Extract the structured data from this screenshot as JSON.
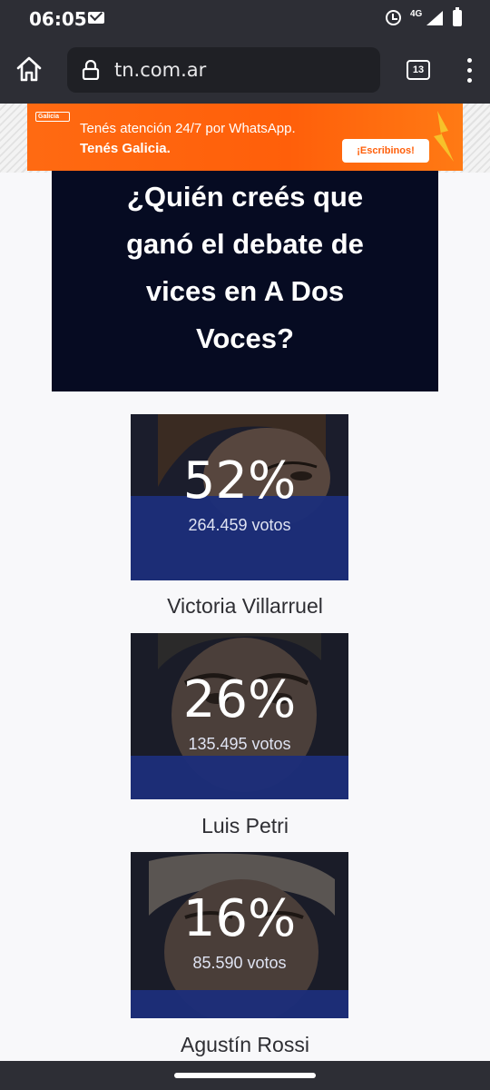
{
  "status_bar": {
    "time": "06:05",
    "network": "4G",
    "icons": [
      "mail-icon",
      "alarm-icon",
      "signal-icon",
      "battery-icon"
    ]
  },
  "browser": {
    "url": "tn.com.ar",
    "tab_count": "13",
    "icons": [
      "home-icon",
      "lock-icon",
      "menu-icon"
    ]
  },
  "ad": {
    "logo": "Galicia",
    "line1": "Tenés atención 24/7 por WhatsApp.",
    "line2": "Tenés Galicia.",
    "cta": "¡Escribinos!"
  },
  "poll": {
    "question": "¿Quién creés que ganó el debate de vices en A Dos Voces?",
    "results": [
      {
        "percent": "52%",
        "share": 52,
        "votes": "264.459 votos",
        "name": "Victoria Villarruel"
      },
      {
        "percent": "26%",
        "share": 26,
        "votes": "135.495 votos",
        "name": "Luis Petri"
      },
      {
        "percent": "16%",
        "share": 16,
        "votes": "85.590 votos",
        "name": "Agustín Rossi"
      }
    ]
  },
  "colors": {
    "chrome": "#2d2e35",
    "ad_orange": "#ff6a12",
    "question_bg": "#060b22",
    "result_bar": "#1c2e7a",
    "page_bg": "#f8f8fa"
  }
}
